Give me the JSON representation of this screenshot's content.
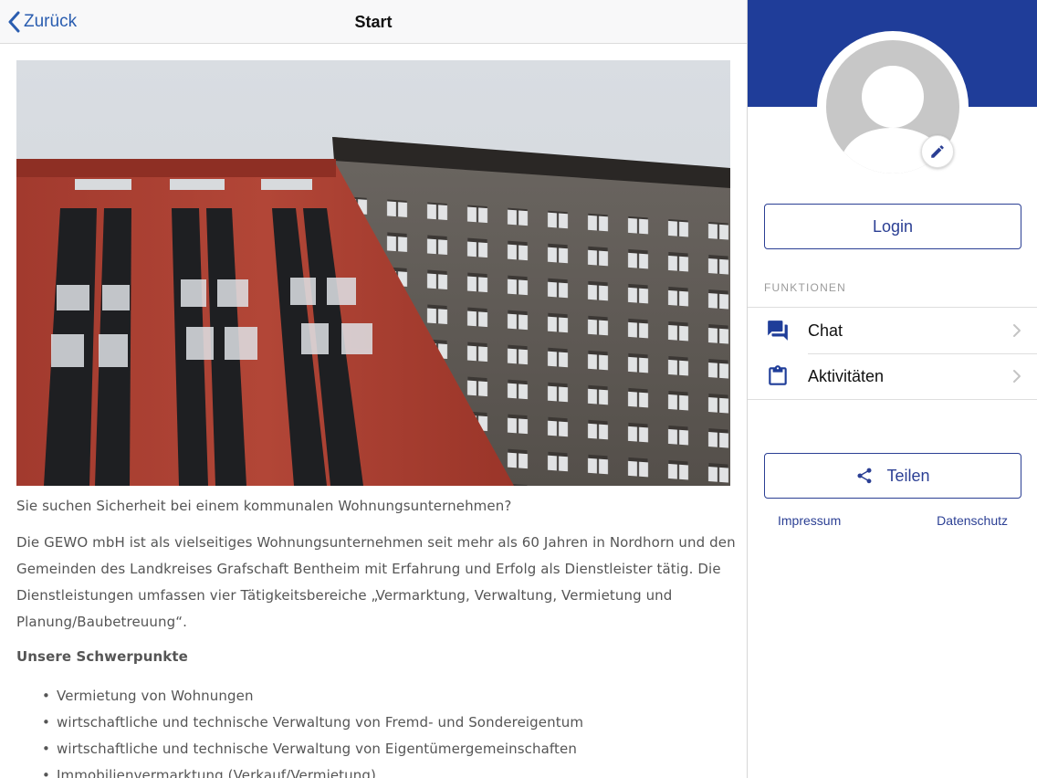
{
  "navbar": {
    "back_label": "Zurück",
    "title": "Start"
  },
  "article": {
    "lead": "Sie suchen Sicherheit bei einem kommunalen Wohnungsunternehmen?",
    "body": "Die GEWO mbH ist als vielseitiges Wohnungsunternehmen seit mehr als 60 Jahren in Nordhorn und den Gemeinden des Landkreises Grafschaft Bentheim mit Erfahrung und Erfolg als Dienstleister tätig. Die Dienstleistungen umfassen vier Tätigkeitsbereiche „Vermarktung, Verwaltung, Vermietung und Planung/Baubetreuung“.",
    "heading": "Unsere Schwerpunkte",
    "focus_items": [
      "Vermietung von Wohnungen",
      "wirtschaftliche und technische Verwaltung von Fremd- und Sondereigentum",
      "wirtschaftliche und technische Verwaltung von Eigentümergemeinschaften",
      "Immobilienvermarktung (Verkauf/Vermietung)"
    ]
  },
  "sidebar": {
    "login_label": "Login",
    "section_title": "FUNKTIONEN",
    "menu": [
      {
        "label": "Chat",
        "icon": "chat-icon"
      },
      {
        "label": "Aktivitäten",
        "icon": "clipboard-icon"
      }
    ],
    "share_label": "Teilen",
    "footer": {
      "impressum": "Impressum",
      "datenschutz": "Datenschutz"
    }
  },
  "colors": {
    "brand": "#1f3d99",
    "accent": "#2b3f94",
    "link": "#2a5db0",
    "avatar": "#c7c7c7"
  }
}
